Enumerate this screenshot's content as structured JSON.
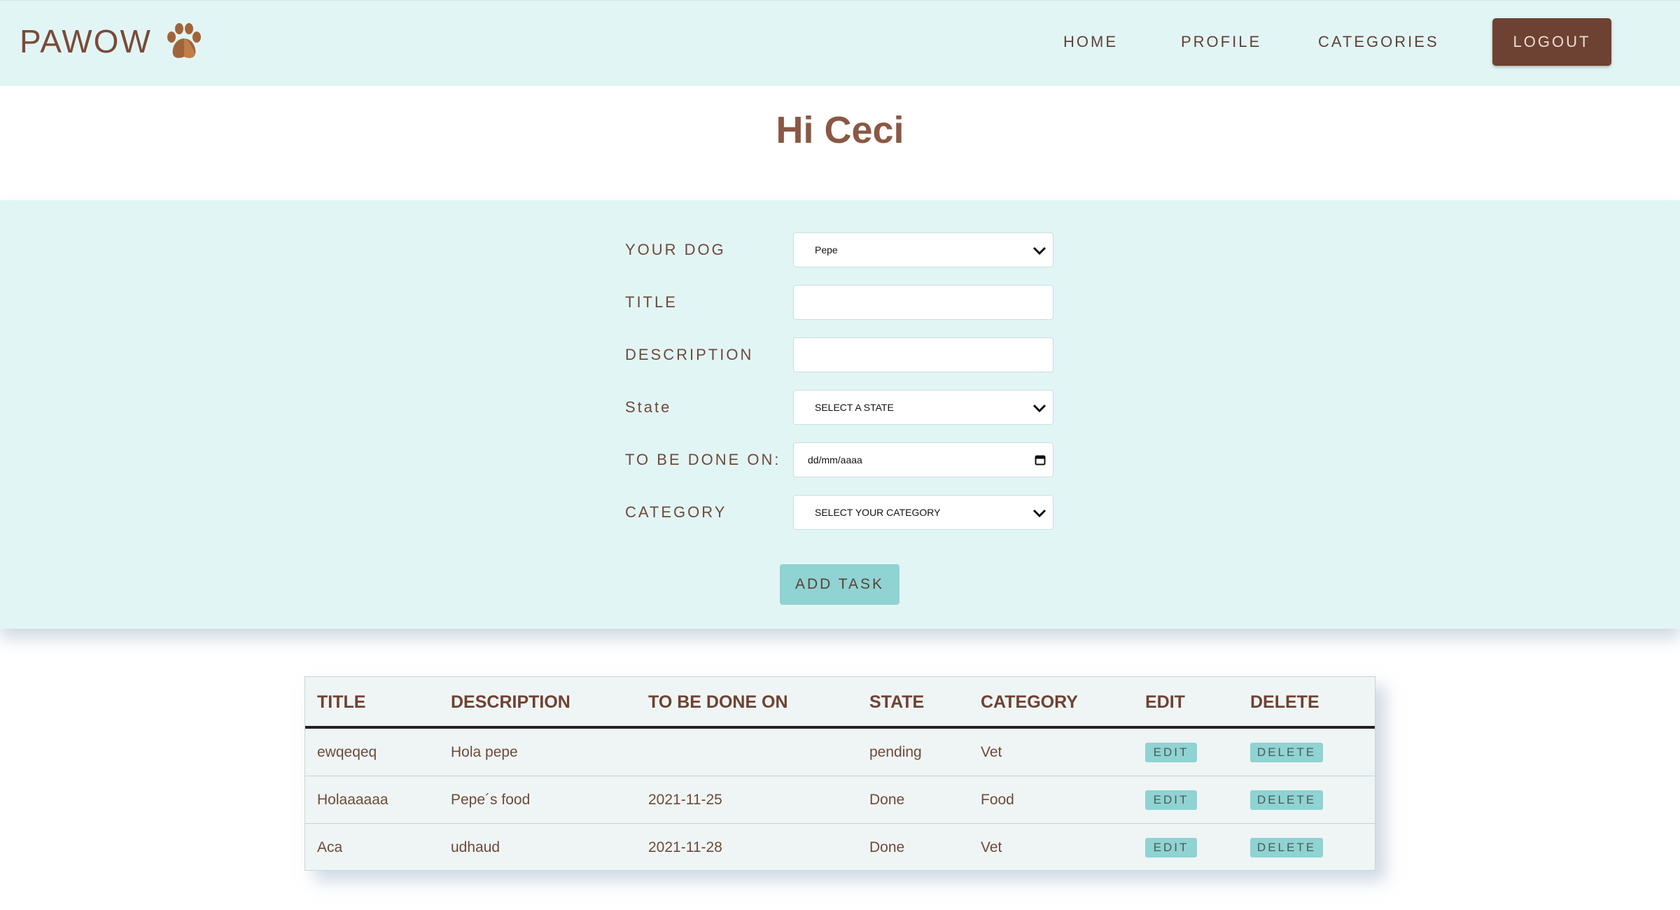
{
  "nav": {
    "brand": "PAWOW",
    "links": [
      "HOME",
      "PROFILE",
      "CATEGORIES"
    ],
    "logout": "LOGOUT"
  },
  "greeting": "Hi Ceci",
  "form": {
    "dog_label": "YOUR DOG",
    "dog_value": "Pepe",
    "title_label": "TITLE",
    "title_value": "",
    "description_label": "DESCRIPTION",
    "description_value": "",
    "state_label": "State",
    "state_value": "SELECT A STATE",
    "date_label": "TO BE DONE ON:",
    "date_placeholder": "dd/mm/aaaa",
    "category_label": "CATEGORY",
    "category_value": "SELECT YOUR CATEGORY",
    "submit": "ADD TASK"
  },
  "table": {
    "headers": [
      "TITLE",
      "DESCRIPTION",
      "TO BE DONE ON",
      "STATE",
      "CATEGORY",
      "EDIT",
      "DELETE"
    ],
    "rows": [
      {
        "title": "ewqeqeq",
        "description": "Hola pepe",
        "date": "",
        "state": "pending",
        "category": "Vet"
      },
      {
        "title": "Holaaaaaa",
        "description": "Pepe´s food",
        "date": "2021-11-25",
        "state": "Done",
        "category": "Food"
      },
      {
        "title": "Aca",
        "description": "udhaud",
        "date": "2021-11-28",
        "state": "Done",
        "category": "Vet"
      }
    ],
    "edit_label": "EDIT",
    "delete_label": "DELETE"
  },
  "colors": {
    "nav_bg": "#e2f5f5",
    "brand_brown": "#7a4b38",
    "logout_bg": "#6e4232",
    "accent_teal": "#8fd3d2"
  }
}
